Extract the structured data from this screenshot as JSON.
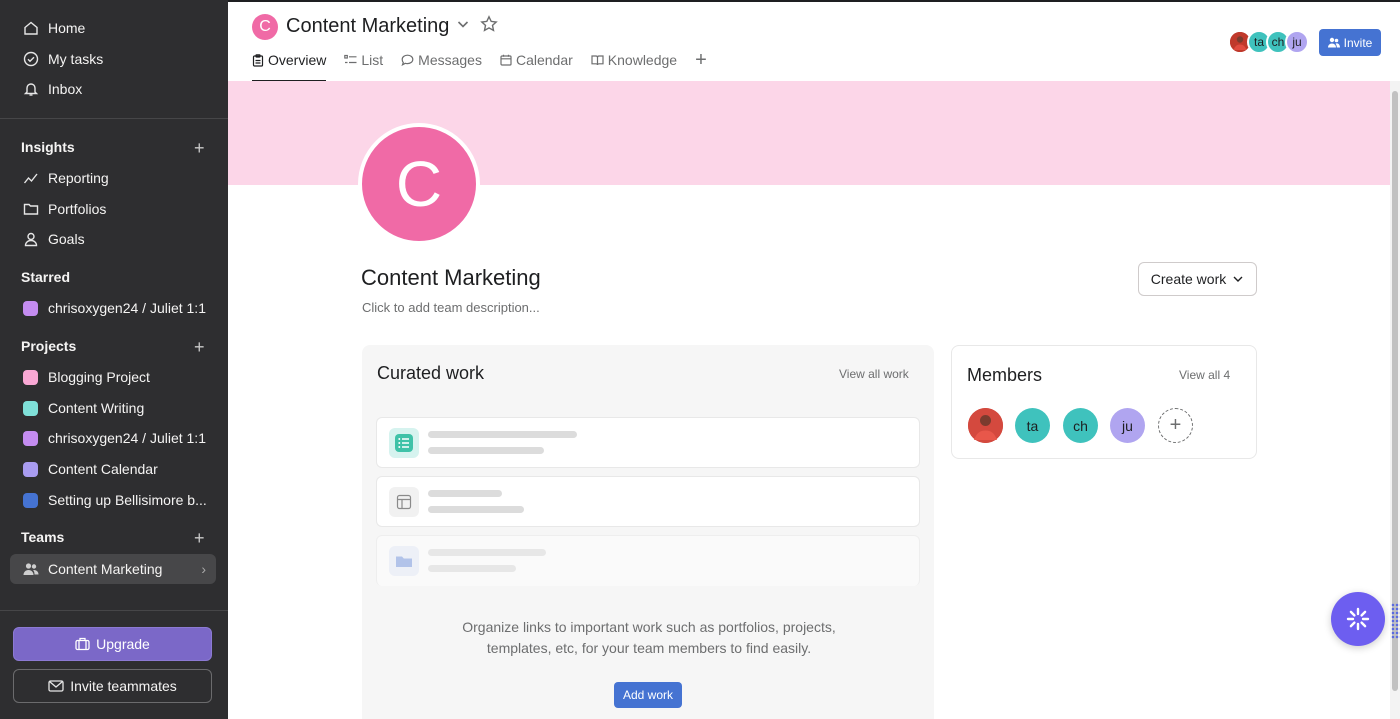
{
  "sidebar": {
    "nav": [
      {
        "label": "Home",
        "icon": "home-icon"
      },
      {
        "label": "My tasks",
        "icon": "check-circle-icon"
      },
      {
        "label": "Inbox",
        "icon": "bell-icon"
      }
    ],
    "insights": {
      "title": "Insights",
      "items": [
        {
          "label": "Reporting",
          "icon": "chart-line-icon"
        },
        {
          "label": "Portfolios",
          "icon": "folder-icon"
        },
        {
          "label": "Goals",
          "icon": "person-icon"
        }
      ]
    },
    "starred": {
      "title": "Starred",
      "items": [
        {
          "label": "chrisoxygen24 / Juliet 1:1",
          "color": "#c48cf0"
        }
      ]
    },
    "projects": {
      "title": "Projects",
      "items": [
        {
          "label": "Blogging Project",
          "color": "#f9a8d4"
        },
        {
          "label": "Content Writing",
          "color": "#7fe0d8"
        },
        {
          "label": "chrisoxygen24 / Juliet 1:1",
          "color": "#c48cf0"
        },
        {
          "label": "Content Calendar",
          "color": "#a99cf0"
        },
        {
          "label": "Setting up Bellisimore b...",
          "color": "#4573d2"
        }
      ]
    },
    "teams": {
      "title": "Teams",
      "items": [
        {
          "label": "Content Marketing"
        }
      ]
    },
    "upgrade_label": "Upgrade",
    "invite_teammates_label": "Invite teammates"
  },
  "header": {
    "logo_letter": "C",
    "title": "Content Marketing",
    "tabs": [
      {
        "label": "Overview",
        "icon": "clipboard-icon",
        "active": true
      },
      {
        "label": "List",
        "icon": "list-icon"
      },
      {
        "label": "Messages",
        "icon": "chat-icon"
      },
      {
        "label": "Calendar",
        "icon": "calendar-icon"
      },
      {
        "label": "Knowledge",
        "icon": "book-icon"
      }
    ],
    "avatars": [
      "ta",
      "ch",
      "ju"
    ],
    "invite_label": "Invite"
  },
  "main": {
    "logo_letter": "C",
    "title": "Content Marketing",
    "description_placeholder": "Click to add team description...",
    "create_work_label": "Create work",
    "curated": {
      "title": "Curated work",
      "view_all": "View all work",
      "empty_text": "Organize links to important work such as portfolios, projects, templates, etc, for your team members to find easily.",
      "add_work_label": "Add work"
    },
    "members": {
      "title": "Members",
      "view_all": "View all 4",
      "list": [
        {
          "initials": "ta",
          "color": "#3fc2bd"
        },
        {
          "initials": "ch",
          "color": "#3fc2bd"
        },
        {
          "initials": "ju",
          "color": "#b0a5f0"
        }
      ]
    }
  },
  "colors": {
    "brand_pink": "#f06aa6",
    "banner": "#fcd6e8",
    "accent_blue": "#4573d2",
    "upgrade_purple": "#7b68c8"
  }
}
